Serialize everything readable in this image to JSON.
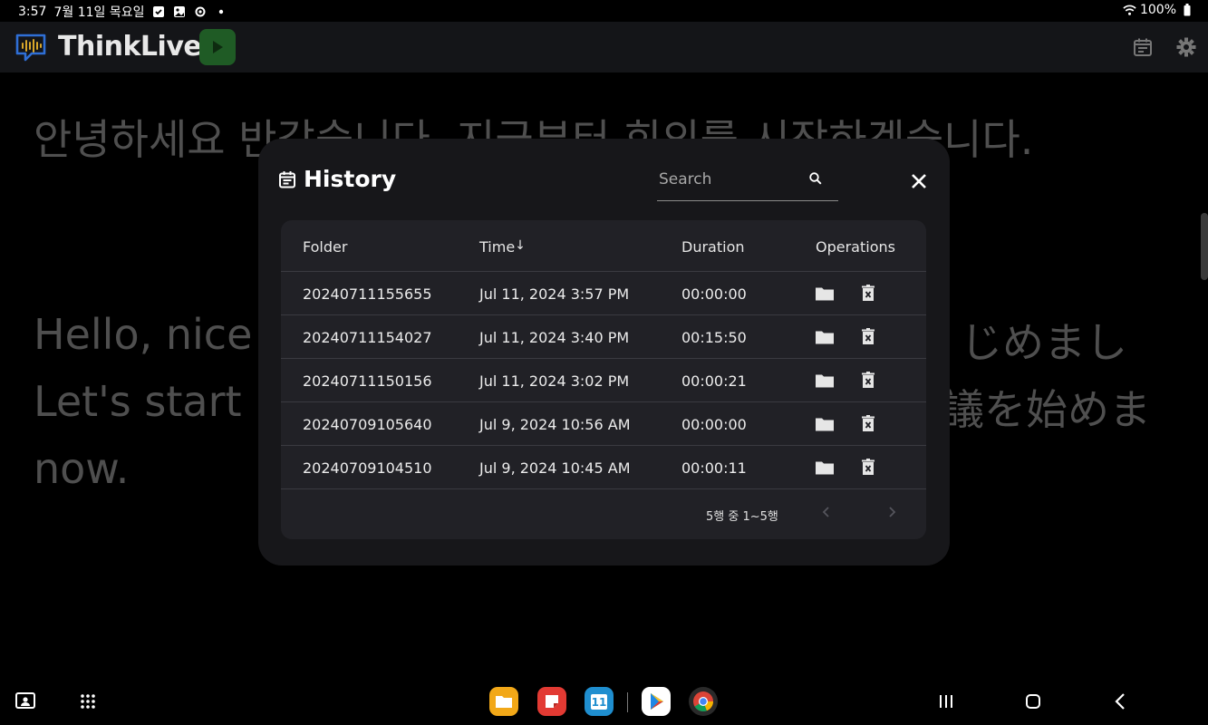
{
  "status_bar": {
    "time": "3:57",
    "date": "7월 11일 목요일",
    "battery": "100%"
  },
  "app": {
    "title": "ThinkLive"
  },
  "transcript": {
    "korean": "안녕하세요 반갑습니다. 지금부터 회의를 시작하겠습니다.",
    "english_line1": "Hello, nice",
    "english_line2": "Let's start",
    "english_line3": "now.",
    "japanese_line1": "じめまし",
    "japanese_line2": "議を始めま"
  },
  "history_modal": {
    "title": "History",
    "search_placeholder": "Search",
    "columns": {
      "folder": "Folder",
      "time": "Time",
      "duration": "Duration",
      "operations": "Operations"
    },
    "sort_indicator": "↓",
    "rows": [
      {
        "folder": "20240711155655",
        "time": "Jul 11, 2024 3:57 PM",
        "duration": "00:00:00"
      },
      {
        "folder": "20240711154027",
        "time": "Jul 11, 2024 3:40 PM",
        "duration": "00:15:50"
      },
      {
        "folder": "20240711150156",
        "time": "Jul 11, 2024 3:02 PM",
        "duration": "00:00:21"
      },
      {
        "folder": "20240709105640",
        "time": "Jul 9, 2024 10:56 AM",
        "duration": "00:00:00"
      },
      {
        "folder": "20240709104510",
        "time": "Jul 9, 2024 10:45 AM",
        "duration": "00:00:11"
      }
    ],
    "pagination": "5행 중 1~5행"
  },
  "dock": {
    "calendar_day": "11"
  },
  "colors": {
    "accent_play": "#1f5b25",
    "modal_bg": "#17171a",
    "card_bg": "#212126"
  }
}
